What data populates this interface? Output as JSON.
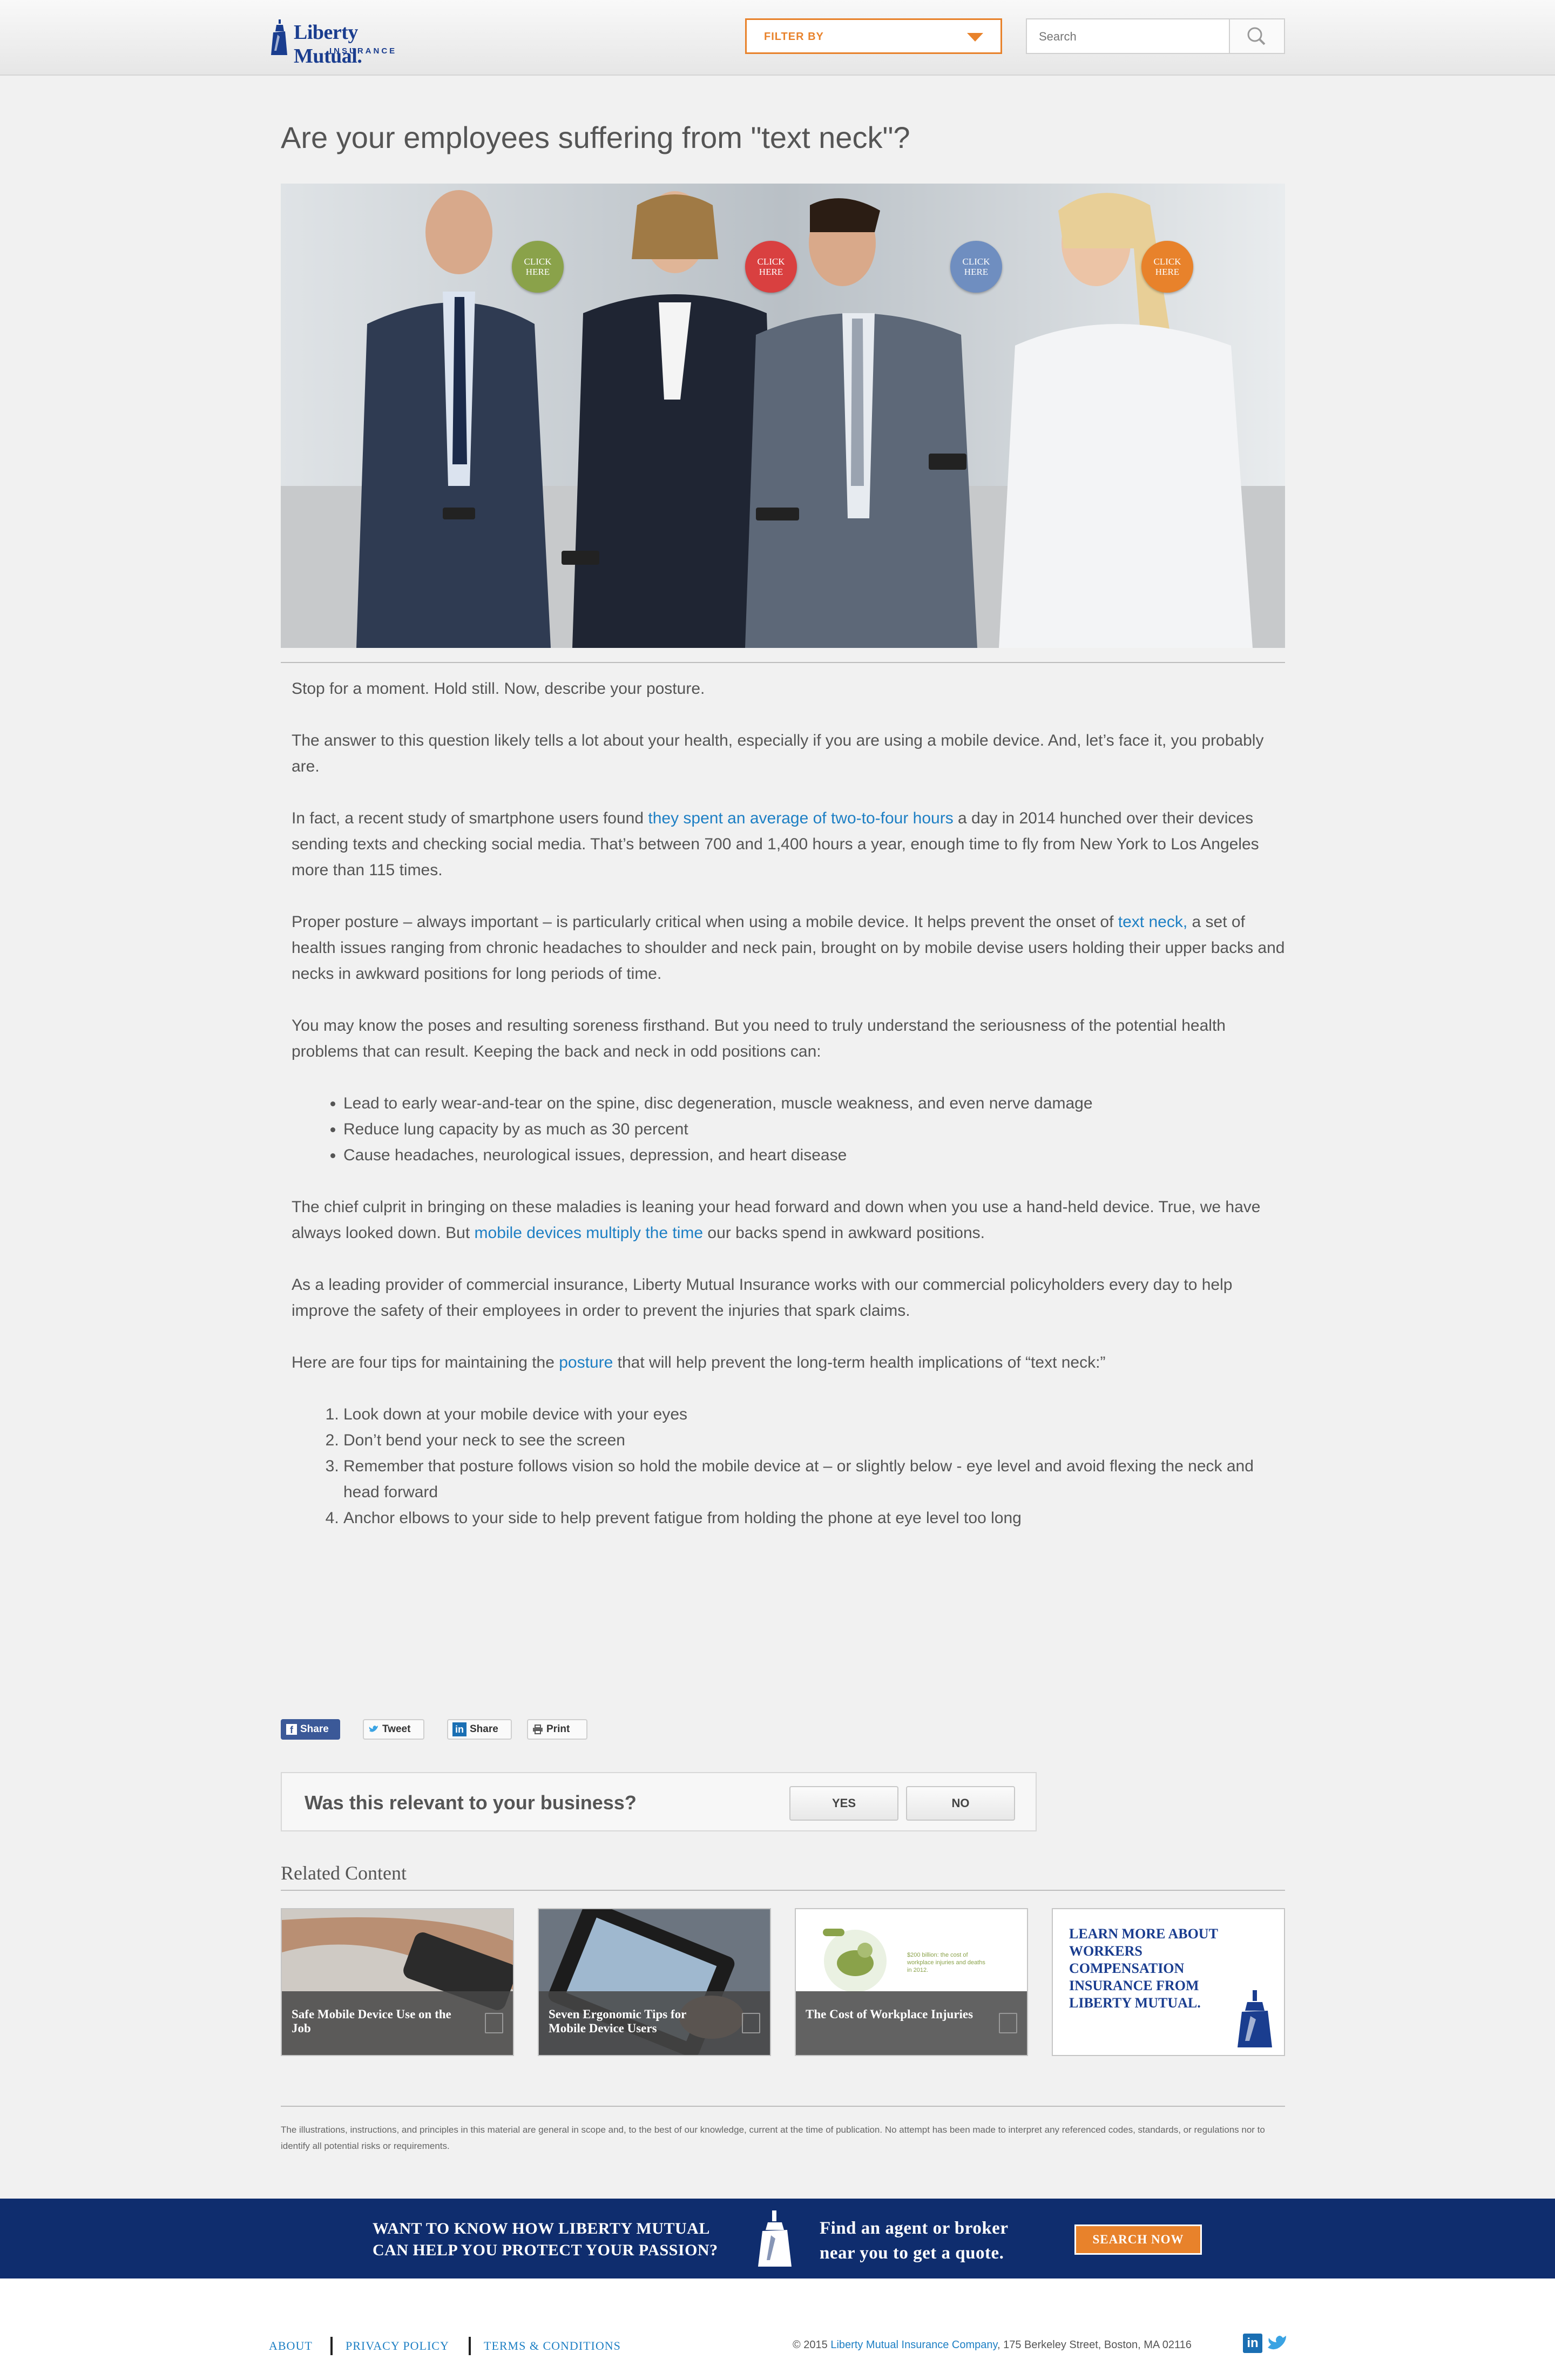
{
  "header": {
    "logo_name": "Liberty Mutual.",
    "logo_sub": "INSURANCE",
    "filter_label": "FILTER BY",
    "search_placeholder": "Search"
  },
  "article": {
    "title": "Are your employees suffering from \"text neck\"?",
    "hotspot_label_line1": "CLICK",
    "hotspot_label_line2": "HERE",
    "hotspot_colors": [
      "#8aa24a",
      "#d94040",
      "#6f8ec0",
      "#e8822b"
    ],
    "p1": "Stop for a moment. Hold still. Now, describe your posture.",
    "p2": "The answer to this question likely tells a lot about your health, especially if you are using a mobile device. And, let’s face it, you probably are.",
    "p3_a": "In fact, a recent study of smartphone users found ",
    "p3_link": "they spent an average of two-to-four hours",
    "p3_b": " a day in 2014 hunched over their devices sending texts and checking social media. That’s between 700 and 1,400 hours a year, enough time to fly from New York to Los Angeles more than 115 times.",
    "p4_a": "Proper posture – always important – is particularly critical when using a mobile device. It helps prevent the onset of ",
    "p4_link": "text neck,",
    "p4_b": " a set of health issues ranging from chronic headaches to shoulder and neck pain, brought on by mobile devise users holding their upper backs and necks in awkward positions for long periods of time.",
    "p5": "You may know the poses and resulting soreness firsthand. But you need to truly understand the seriousness of the potential health problems that can result. Keeping the back and neck in odd positions can:",
    "bullets": [
      "Lead to early wear-and-tear on the spine, disc degeneration, muscle weakness, and even nerve damage",
      "Reduce lung capacity by as much as 30 percent",
      "Cause headaches, neurological issues, depression, and heart disease"
    ],
    "p6_a": "The chief culprit in bringing on these maladies is leaning your head forward and down when you use a hand-held device. True, we have always looked down. But ",
    "p6_link": "mobile devices multiply the time",
    "p6_b": " our backs spend in awkward positions.",
    "p7": "As a leading provider of commercial insurance, Liberty Mutual Insurance works with our commercial policyholders every day to help improve the safety of their employees in order to prevent the injuries that spark claims.",
    "p8_a": "Here are four tips for maintaining the ",
    "p8_link": "posture",
    "p8_b": " that will help prevent the long-term health implications of “text neck:”",
    "tips": [
      "Look down at your mobile device with your eyes",
      "Don’t bend your neck to see the screen",
      "Remember that posture follows vision so hold the mobile device at – or slightly below - eye level and avoid flexing the neck and head forward",
      "Anchor elbows to your side to help prevent fatigue from holding the phone at eye level too long"
    ]
  },
  "share": {
    "facebook": "Share",
    "twitter": "Tweet",
    "linkedin": "Share",
    "print": "Print"
  },
  "feedback": {
    "question": "Was this relevant to your business?",
    "yes": "YES",
    "no": "NO"
  },
  "related": {
    "heading": "Related Content",
    "cards": [
      {
        "title": "Safe Mobile Device Use on the Job"
      },
      {
        "title": "Seven Ergonomic Tips for Mobile Device Users"
      },
      {
        "title": "The Cost of Workplace Injuries",
        "inset_text": "$200 billion: the cost of workplace injuries and deaths in 2012."
      },
      {
        "title": "LEARN MORE ABOUT WORKERS COMPENSATION INSURANCE FROM LIBERTY MUTUAL."
      }
    ]
  },
  "disclaimer": "The illustrations, instructions, and principles in this material are general in scope and, to the best of our knowledge, current at the time of publication. No attempt has been made to interpret any referenced codes, standards, or regulations nor to identify all potential risks or requirements.",
  "banner": {
    "left_line1": "WANT TO KNOW HOW LIBERTY MUTUAL",
    "left_line2": "CAN HELP YOU PROTECT YOUR PASSION?",
    "right_line1": "Find an agent or broker",
    "right_line2": "near you to get a quote.",
    "button": "SEARCH NOW"
  },
  "footer": {
    "about": "ABOUT",
    "privacy": "PRIVACY POLICY",
    "terms": "TERMS & CONDITIONS",
    "copy_a": "© 2015 ",
    "copy_link": "Liberty Mutual Insurance Company",
    "copy_b": ", 175 Berkeley Street, Boston, MA 02116",
    "linkedin_glyph": "in"
  },
  "colors": {
    "brand_blue": "#1a3d8f",
    "accent_orange": "#e8822b",
    "link_blue": "#1d7fc4",
    "banner_navy": "#0f2d6e"
  }
}
